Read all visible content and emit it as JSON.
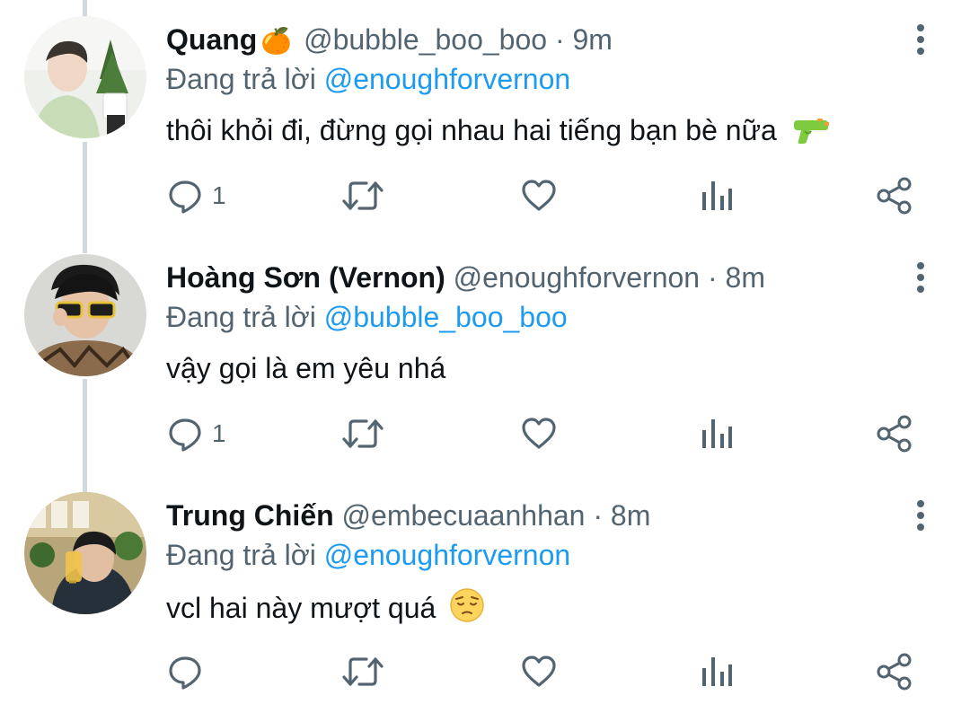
{
  "tweets": [
    {
      "name": "Quang",
      "name_emoji": "🍊",
      "handle": "@bubble_boo_boo",
      "separator": "·",
      "time": "9m",
      "reply_prefix": "Đang trả lời",
      "reply_to": "@enoughforvernon",
      "text": "thôi khỏi đi, đừng gọi nhau hai tiếng bạn bè nữa",
      "text_emoji": "water-pistol-icon",
      "reply_count": "1"
    },
    {
      "name": "Hoàng Sơn (Vernon)",
      "handle": "@enoughforvernon",
      "separator": "·",
      "time": "8m",
      "reply_prefix": "Đang trả lời",
      "reply_to": "@bubble_boo_boo",
      "text": "vậy gọi là em yêu nhá",
      "reply_count": "1"
    },
    {
      "name": "Trung Chiến",
      "handle": "@embecuaanhhan",
      "separator": "·",
      "time": "8m",
      "reply_prefix": "Đang trả lời",
      "reply_to": "@enoughforvernon",
      "text": "vcl hai này mượt quá",
      "text_emoji": "pensive-face-icon",
      "reply_count": ""
    }
  ],
  "colors": {
    "text": "#0f1419",
    "secondary": "#536471",
    "accent": "#1d9bf0",
    "thread_line": "#cfd9de"
  },
  "icons": {
    "reply": "reply-bubble-icon",
    "retweet": "retweet-icon",
    "like": "heart-icon",
    "stats": "bar-chart-icon",
    "share": "share-icon",
    "more": "more-vertical-icon"
  }
}
